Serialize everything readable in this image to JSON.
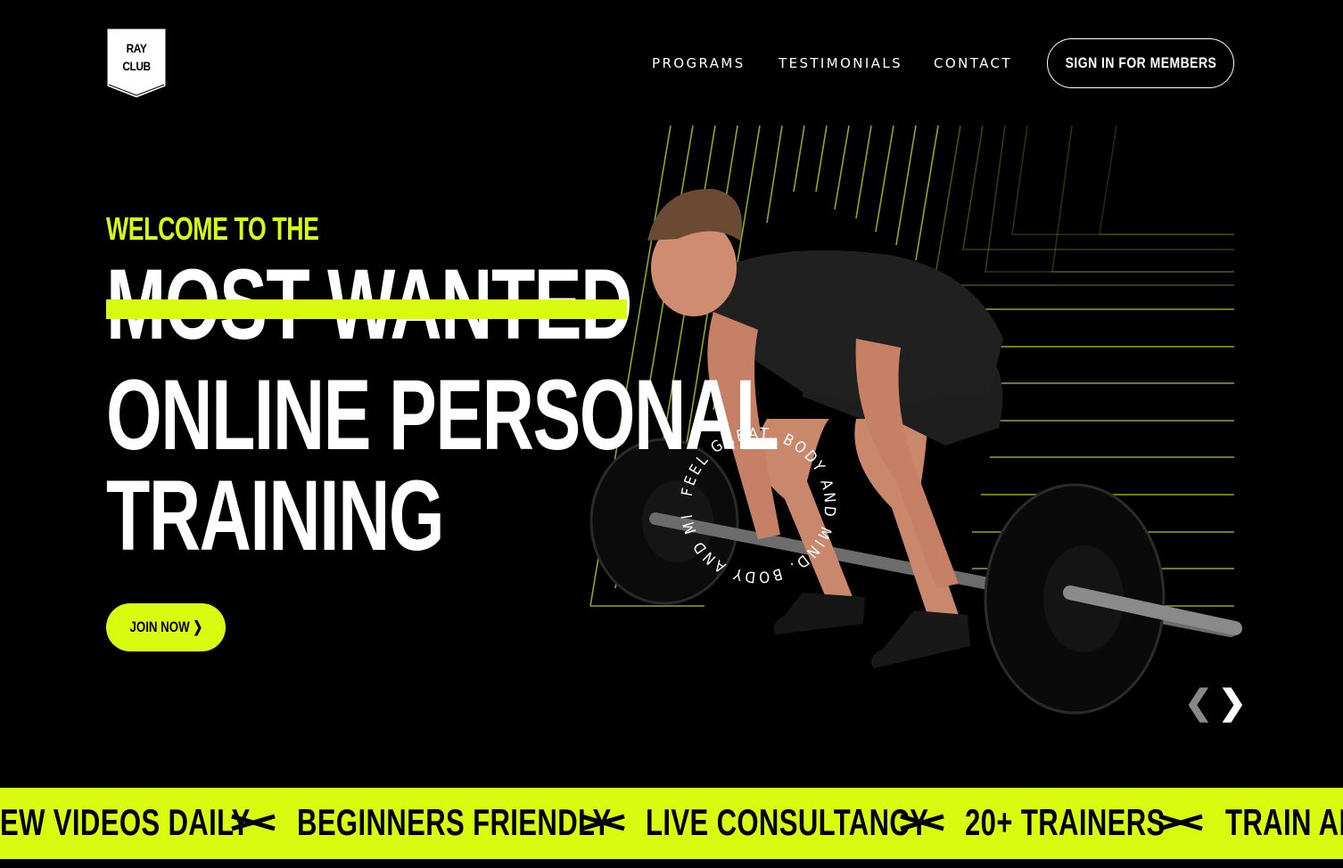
{
  "brand": {
    "logo_line1": "RAY",
    "logo_line2": "CLUB"
  },
  "nav": {
    "programs": "PROGRAMS",
    "testimonials": "TESTIMONIALS",
    "contact": "CONTACT",
    "signin": "SIGN IN FOR MEMBERS"
  },
  "hero": {
    "welcome": "WELCOME TO THE",
    "line1": "MOST WANTED",
    "line2": "ONLINE PERSONAL",
    "line3": "TRAINING",
    "cta": "JOIN NOW ❯",
    "circle_text": "FEEL GREAT. BODY AND MIND. BODY AND MIND."
  },
  "carousel": {
    "prev": "❮",
    "next": "❯"
  },
  "ticker": {
    "items": [
      "EW VIDEOS DAILY",
      "BEGINNERS FRIENDLY",
      "LIVE CONSULTANCY",
      "20+ TRAINERS",
      "TRAIN ANY"
    ]
  },
  "colors": {
    "accent": "#d9fb0f",
    "background": "#000000",
    "text": "#ffffff"
  }
}
